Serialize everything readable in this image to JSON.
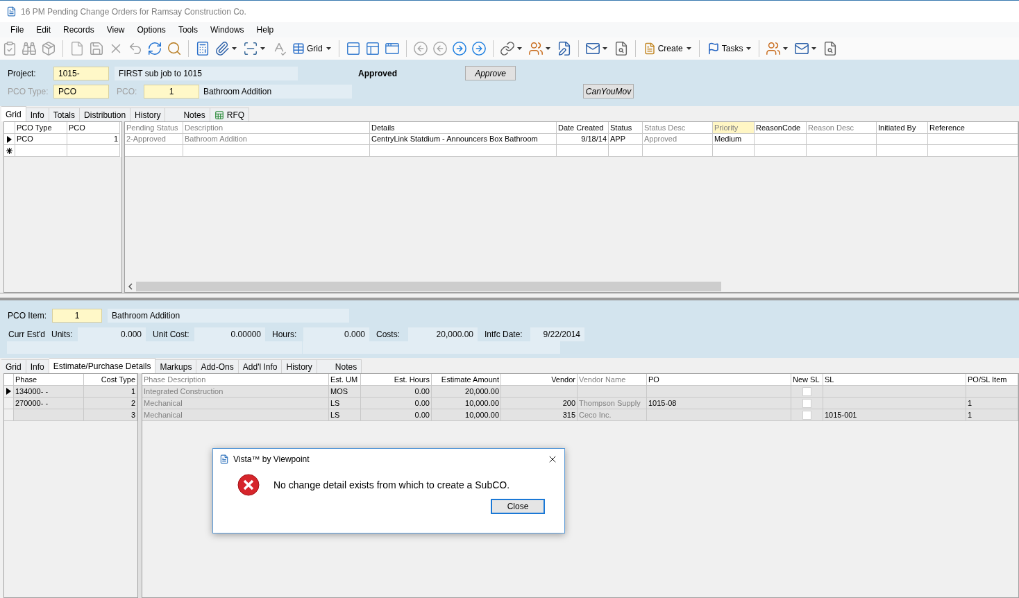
{
  "window": {
    "title": "16 PM Pending Change Orders for Ramsay Construction Co."
  },
  "menu": [
    "File",
    "Edit",
    "Records",
    "View",
    "Options",
    "Tools",
    "Windows",
    "Help"
  ],
  "toolbar": {
    "labels": [
      "Grid",
      "Create",
      "Tasks"
    ]
  },
  "header": {
    "project_label": "Project:",
    "project_value": "1015-",
    "project_desc": "FIRST sub job to 1015",
    "status": "Approved",
    "approve_button": "Approve",
    "move_button": "CanYouMov",
    "pco_type_label": "PCO Type:",
    "pco_type_label_disabled": true,
    "pco_type_value": "PCO",
    "pco_label": "PCO:",
    "pco_label_disabled": true,
    "pco_value": "1",
    "pco_desc": "Bathroom Addition"
  },
  "tabs": [
    {
      "label": "Grid",
      "selected": true
    },
    {
      "label": "Info",
      "selected": false
    },
    {
      "label": "Totals",
      "selected": false
    },
    {
      "label": "Distribution",
      "selected": false
    },
    {
      "label": "History",
      "selected": false
    },
    {
      "label": "Notes",
      "selected": false
    },
    {
      "label": "RFQ",
      "selected": false
    }
  ],
  "upper_grid": {
    "frozen_columns": [
      "PCO Type",
      "PCO"
    ],
    "columns": [
      {
        "label": "Pending Status",
        "dim": true,
        "selected": false
      },
      {
        "label": "Description",
        "dim": true,
        "selected": false
      },
      {
        "label": "Details",
        "dim": false,
        "selected": false
      },
      {
        "label": "Date Created",
        "dim": false,
        "selected": false
      },
      {
        "label": "Status",
        "dim": false,
        "selected": false
      },
      {
        "label": "Status Desc",
        "dim": true,
        "selected": false
      },
      {
        "label": "Priority",
        "dim": true,
        "selected": true
      },
      {
        "label": "ReasonCode",
        "dim": false,
        "selected": false
      },
      {
        "label": "Reason Desc",
        "dim": true,
        "selected": false
      },
      {
        "label": "Initiated By",
        "dim": false,
        "selected": false
      },
      {
        "label": "Reference",
        "dim": false,
        "selected": false
      }
    ],
    "rows": [
      {
        "current": true,
        "frozen": [
          "PCO",
          "1"
        ],
        "cells": [
          "2-Approved",
          "Bathroom Addition",
          "CentryLink Statdium - Announcers Box Bathroom",
          "9/18/14",
          "APP",
          "Approved",
          "Medium",
          null,
          null,
          null,
          null
        ]
      }
    ]
  },
  "lower_header": {
    "item_label": "PCO Item:",
    "item_value": "1",
    "item_desc": "Bathroom Addition",
    "est_label": "Curr Est'd",
    "units_label": "Units:",
    "units": "0.000",
    "unit_cost_label": "Unit Cost:",
    "unit_cost": "0.00000",
    "hours_label": "Hours:",
    "hours": "0.000",
    "costs_label": "Costs:",
    "costs": "20,000.00",
    "intfc_label": "Intfc Date:",
    "intfc_date": "9/22/2014"
  },
  "lower_tabs": [
    {
      "label": "Grid",
      "selected": false
    },
    {
      "label": "Info",
      "selected": false
    },
    {
      "label": "Estimate/Purchase Details",
      "selected": true
    },
    {
      "label": "Markups",
      "selected": false
    },
    {
      "label": "Add-Ons",
      "selected": false
    },
    {
      "label": "Add'l Info",
      "selected": false
    },
    {
      "label": "History",
      "selected": false
    },
    {
      "label": "Notes",
      "selected": false
    }
  ],
  "lower_grid": {
    "frozen_columns": [
      "Phase",
      "Cost Type"
    ],
    "columns": [
      {
        "label": "Phase Description",
        "dim": true
      },
      {
        "label": "Est. UM",
        "dim": false
      },
      {
        "label": "Est. Hours",
        "dim": false
      },
      {
        "label": "Estimate Amount",
        "dim": false
      },
      {
        "label": "Vendor",
        "dim": false
      },
      {
        "label": "Vendor Name",
        "dim": true
      },
      {
        "label": "PO",
        "dim": false
      },
      {
        "label": "New SL",
        "dim": false
      },
      {
        "label": "SL",
        "dim": false
      },
      {
        "label": "PO/SL Item",
        "dim": false
      }
    ],
    "rows": [
      {
        "current": true,
        "phase": "134000-  -",
        "cost_type": "1",
        "new_sl": false,
        "cells": [
          "Integrated Construction",
          "MOS",
          "0.00",
          "20,000.00",
          null,
          null,
          null,
          null,
          null,
          null
        ]
      },
      {
        "current": false,
        "phase": "270000-  -",
        "cost_type": "2",
        "new_sl": false,
        "cells": [
          "Mechanical",
          "LS",
          "0.00",
          "10,000.00",
          "200",
          "Thompson Supply",
          "1015-08",
          null,
          null,
          "1"
        ]
      },
      {
        "current": false,
        "cost_type": "3",
        "new_sl": false,
        "cells": [
          "Mechanical",
          "LS",
          "0.00",
          "10,000.00",
          "315",
          "Ceco Inc.",
          null,
          null,
          "1015-001",
          "1"
        ]
      }
    ]
  },
  "dialog": {
    "title": "Vista™ by Viewpoint",
    "message": "No change detail exists from which to create a SubCO.",
    "button": "Close"
  }
}
